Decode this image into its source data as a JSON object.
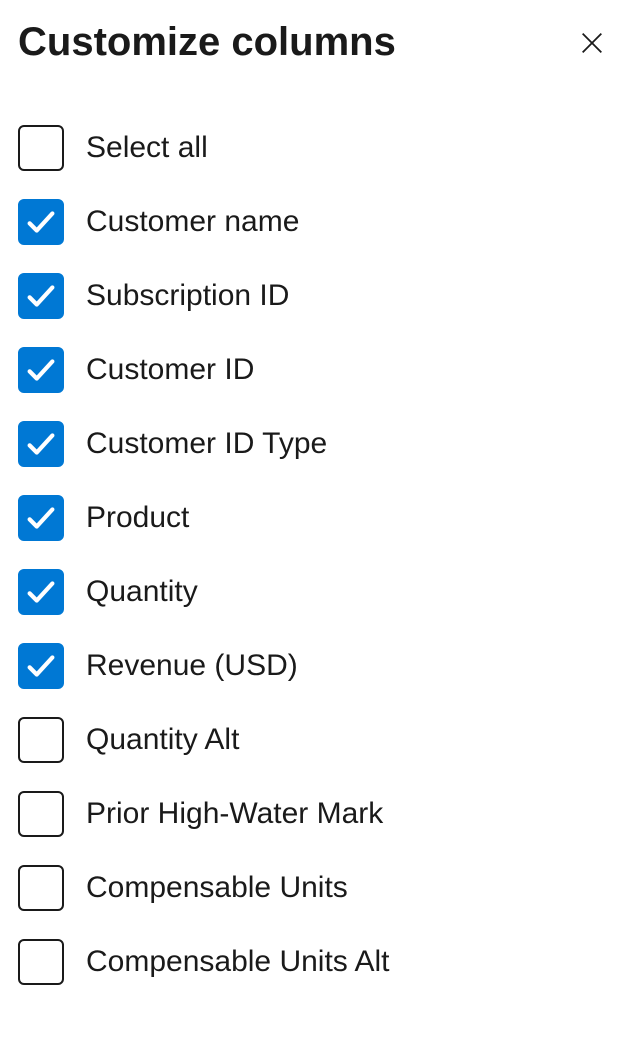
{
  "panel": {
    "title": "Customize columns"
  },
  "items": [
    {
      "label": "Select all",
      "checked": false
    },
    {
      "label": "Customer name",
      "checked": true
    },
    {
      "label": "Subscription ID",
      "checked": true
    },
    {
      "label": "Customer ID",
      "checked": true
    },
    {
      "label": "Customer ID Type",
      "checked": true
    },
    {
      "label": "Product",
      "checked": true
    },
    {
      "label": "Quantity",
      "checked": true
    },
    {
      "label": "Revenue (USD)",
      "checked": true
    },
    {
      "label": "Quantity Alt",
      "checked": false
    },
    {
      "label": "Prior High-Water Mark",
      "checked": false
    },
    {
      "label": "Compensable Units",
      "checked": false
    },
    {
      "label": "Compensable Units Alt",
      "checked": false
    }
  ]
}
